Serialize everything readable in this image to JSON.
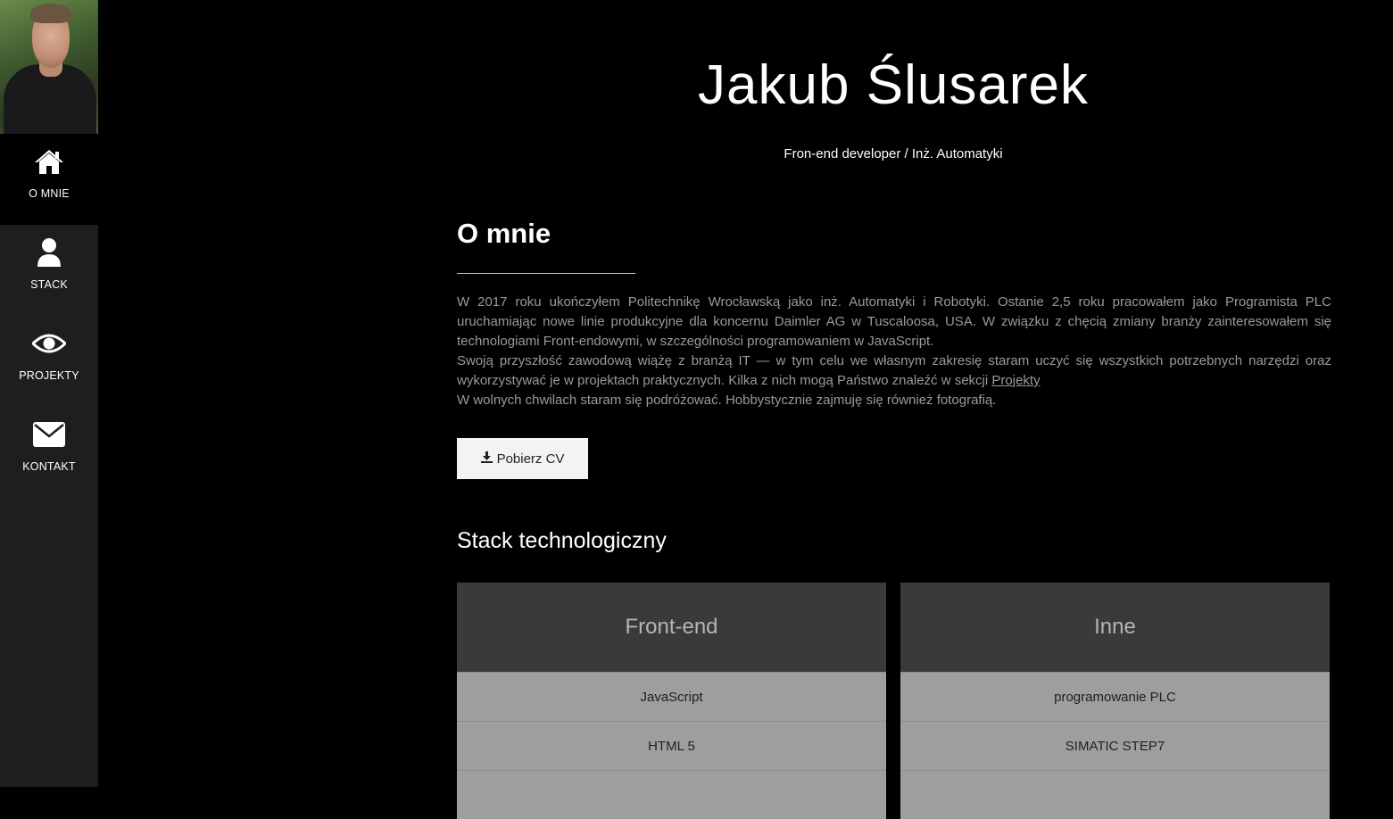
{
  "sidebar": {
    "items": [
      {
        "label": "O MNIE",
        "icon": "home-icon",
        "active": true
      },
      {
        "label": "STACK",
        "icon": "user-icon",
        "active": false
      },
      {
        "label": "PROJEKTY",
        "icon": "eye-icon",
        "active": false
      },
      {
        "label": "KONTAKT",
        "icon": "envelope-icon",
        "active": false
      }
    ]
  },
  "header": {
    "name": "Jakub Ślusarek",
    "subtitle": "Fron-end developer / Inż. Automatyki"
  },
  "about": {
    "title": "O mnie",
    "p1": "W 2017 roku ukończyłem Politechnikę Wrocławską jako inż. Automatyki i Robotyki. Ostanie 2,5 roku pracowałem jako Programista PLC uruchamiając nowe linie produkcyjne dla koncernu Daimler AG w Tuscaloosa, USA. W związku z chęcią zmiany branży zainteresowałem się technologiami Front-endowymi, w szczególności programowaniem w JavaScript.",
    "p2_before_link": "Swoją przyszłość zawodową wiążę z branżą IT — w tym celu we własnym zakresię staram uczyć się wszystkich potrzebnych narzędzi oraz wykorzystywać je w projektach praktycznych. Kilka z nich mogą Państwo znaleźć w sekcji ",
    "p2_link": "Projekty",
    "p3": "W wolnych chwilach staram się podróżować. Hobbystycznie zajmuję się również fotografią.",
    "cv_button": "Pobierz CV"
  },
  "stack": {
    "title": "Stack technologiczny",
    "columns": [
      {
        "title": "Front-end",
        "items": [
          "JavaScript",
          "HTML 5"
        ]
      },
      {
        "title": "Inne",
        "items": [
          "programowanie PLC",
          "SIMATIC STEP7"
        ]
      }
    ]
  },
  "colors": {
    "background": "#000000",
    "sidebar": "#1e1e1e",
    "card_header": "#3a3a3a",
    "card_row": "#9e9e9e"
  }
}
